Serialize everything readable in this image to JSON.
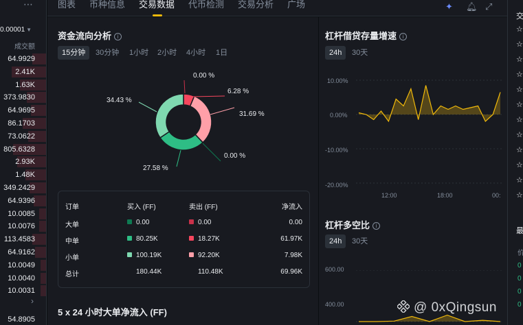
{
  "orderbook": {
    "precision": "0.00001",
    "volume_label": "成交额",
    "values": [
      "64.9929",
      "2.41K",
      "1.63K",
      "373.9830",
      "64.9695",
      "86.1703",
      "73.0622",
      "805.6328",
      "2.93K",
      "1.48K",
      "349.2429",
      "64.9396",
      "10.0085",
      "10.0076",
      "113.4583",
      "64.9162",
      "10.0049",
      "10.0040",
      "10.0031"
    ],
    "last_value": "54.8905"
  },
  "tabs": [
    {
      "label": "图表"
    },
    {
      "label": "币种信息"
    },
    {
      "label": "交易数据"
    },
    {
      "label": "代币检测"
    },
    {
      "label": "交易分析"
    },
    {
      "label": "广场"
    }
  ],
  "active_tab": "交易数据",
  "fund_flow": {
    "title": "资金流向分析",
    "intervals": [
      "15分钟",
      "30分钟",
      "1小时",
      "2小时",
      "4小时",
      "1日"
    ],
    "active_interval": "15分钟",
    "labels": {
      "large_sell": "0.00 %",
      "medium_sell": "6.28 %",
      "small_sell": "31.69 %",
      "large_buy": "0.00 %",
      "medium_buy": "27.58 %",
      "small_buy": "34.43 %"
    },
    "table": {
      "headers": {
        "order": "订单",
        "buy": "买入 (FF)",
        "sell": "卖出 (FF)",
        "net": "净流入"
      },
      "rows": [
        {
          "name": "大单",
          "buy": "0.00",
          "sell": "0.00",
          "net": "0.00",
          "buy_color": "#0e7a52",
          "sell_color": "#c9314a"
        },
        {
          "name": "中单",
          "buy": "80.25K",
          "sell": "18.27K",
          "net": "61.97K",
          "buy_color": "#2ebd85",
          "sell_color": "#f6465d"
        },
        {
          "name": "小单",
          "buy": "100.19K",
          "sell": "92.20K",
          "net": "7.98K",
          "buy_color": "#7fd8b0",
          "sell_color": "#ff9fa8"
        }
      ],
      "total": {
        "name": "总计",
        "buy": "180.44K",
        "sell": "110.48K",
        "net": "69.96K"
      }
    },
    "next_section": "5 x 24 小时大单净流入 (FF)"
  },
  "chart_data": [
    {
      "type": "donut",
      "categories": [
        "大单买入",
        "中单买入",
        "小单买入",
        "大单卖出",
        "中单卖出",
        "小单卖出"
      ],
      "values": [
        0.0,
        27.58,
        34.43,
        0.0,
        6.28,
        31.69
      ],
      "colors": [
        "#0e7a52",
        "#2ebd85",
        "#7fd8b0",
        "#c9314a",
        "#f6465d",
        "#ff9fa8"
      ]
    },
    {
      "type": "area",
      "title": "杠杆借贷存量增速",
      "ranges": [
        "24h",
        "30天"
      ],
      "active_range": "24h",
      "yticks": [
        "10.00%",
        "0.00%",
        "-10.00%",
        "-20.00%"
      ],
      "xticks": [
        "12:00",
        "18:00",
        "00:"
      ],
      "ylim": [
        -20,
        10
      ],
      "values": [
        0.5,
        0.0,
        -1.5,
        1.0,
        -2.0,
        4.5,
        2.5,
        7.5,
        -1.5,
        8.5,
        0.0,
        2.5,
        1.5,
        2.5,
        1.5,
        2.0,
        2.5,
        -2.0,
        0.0,
        6.5
      ],
      "color": "#f0b90b"
    },
    {
      "type": "area",
      "title": "杠杆多空比",
      "ranges": [
        "24h",
        "30天"
      ],
      "active_range": "24h",
      "yticks": [
        "600.00",
        "400.00"
      ],
      "ylim": [
        400,
        600
      ],
      "values": [
        400,
        400,
        402,
        420,
        400,
        425,
        400,
        405,
        400
      ],
      "color": "#f0b90b"
    }
  ],
  "right_strip": {
    "chars": [
      "交",
      "☆",
      "☆",
      "☆",
      "☆",
      "☆",
      "☆",
      "☆",
      "☆",
      "☆",
      "☆",
      "☆",
      "☆"
    ],
    "section": "最",
    "price_label": "价",
    "greens": [
      "0",
      "0",
      "0",
      "0"
    ]
  },
  "watermark": "@ 0xQingsun"
}
